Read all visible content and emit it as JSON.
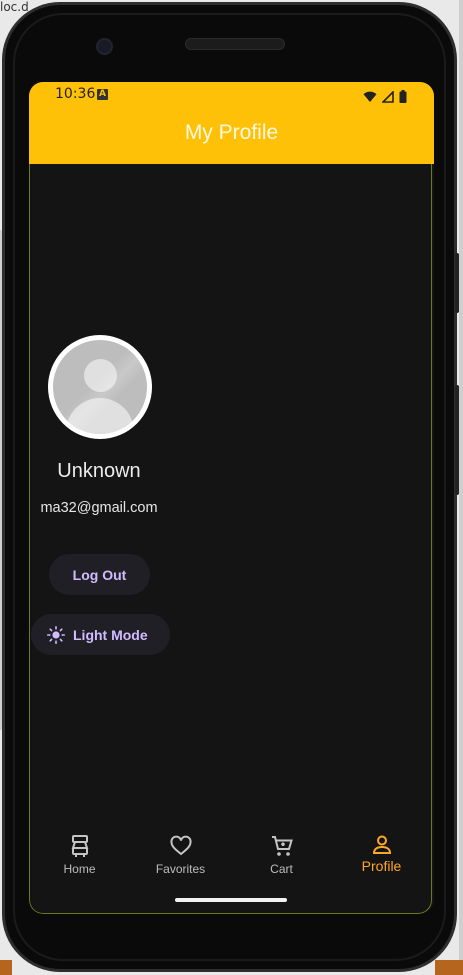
{
  "background": {
    "top_left_text": "loc.d"
  },
  "status_bar": {
    "time": "10:36",
    "notification_glyph": "A",
    "icons": [
      "wifi-icon",
      "cell-signal-icon",
      "battery-icon"
    ]
  },
  "app_bar": {
    "title": "My Profile",
    "color": "#ffc107"
  },
  "profile": {
    "name": "Unknown",
    "email": "ma32@gmail.com",
    "avatar_icon": "default-avatar-icon"
  },
  "actions": {
    "logout_label": "Log Out",
    "theme_toggle_label": "Light Mode",
    "theme_toggle_icon": "sun-icon"
  },
  "bottom_nav": {
    "items": [
      {
        "label": "Home",
        "icon": "home-icon",
        "active": false
      },
      {
        "label": "Favorites",
        "icon": "heart-icon",
        "active": false
      },
      {
        "label": "Cart",
        "icon": "cart-icon",
        "active": false
      },
      {
        "label": "Profile",
        "icon": "person-icon",
        "active": true
      }
    ],
    "active_color": "#ffa726"
  },
  "colors": {
    "screen_background": "#141414",
    "button_text": "#d0bcff",
    "button_background": "#211f26"
  }
}
